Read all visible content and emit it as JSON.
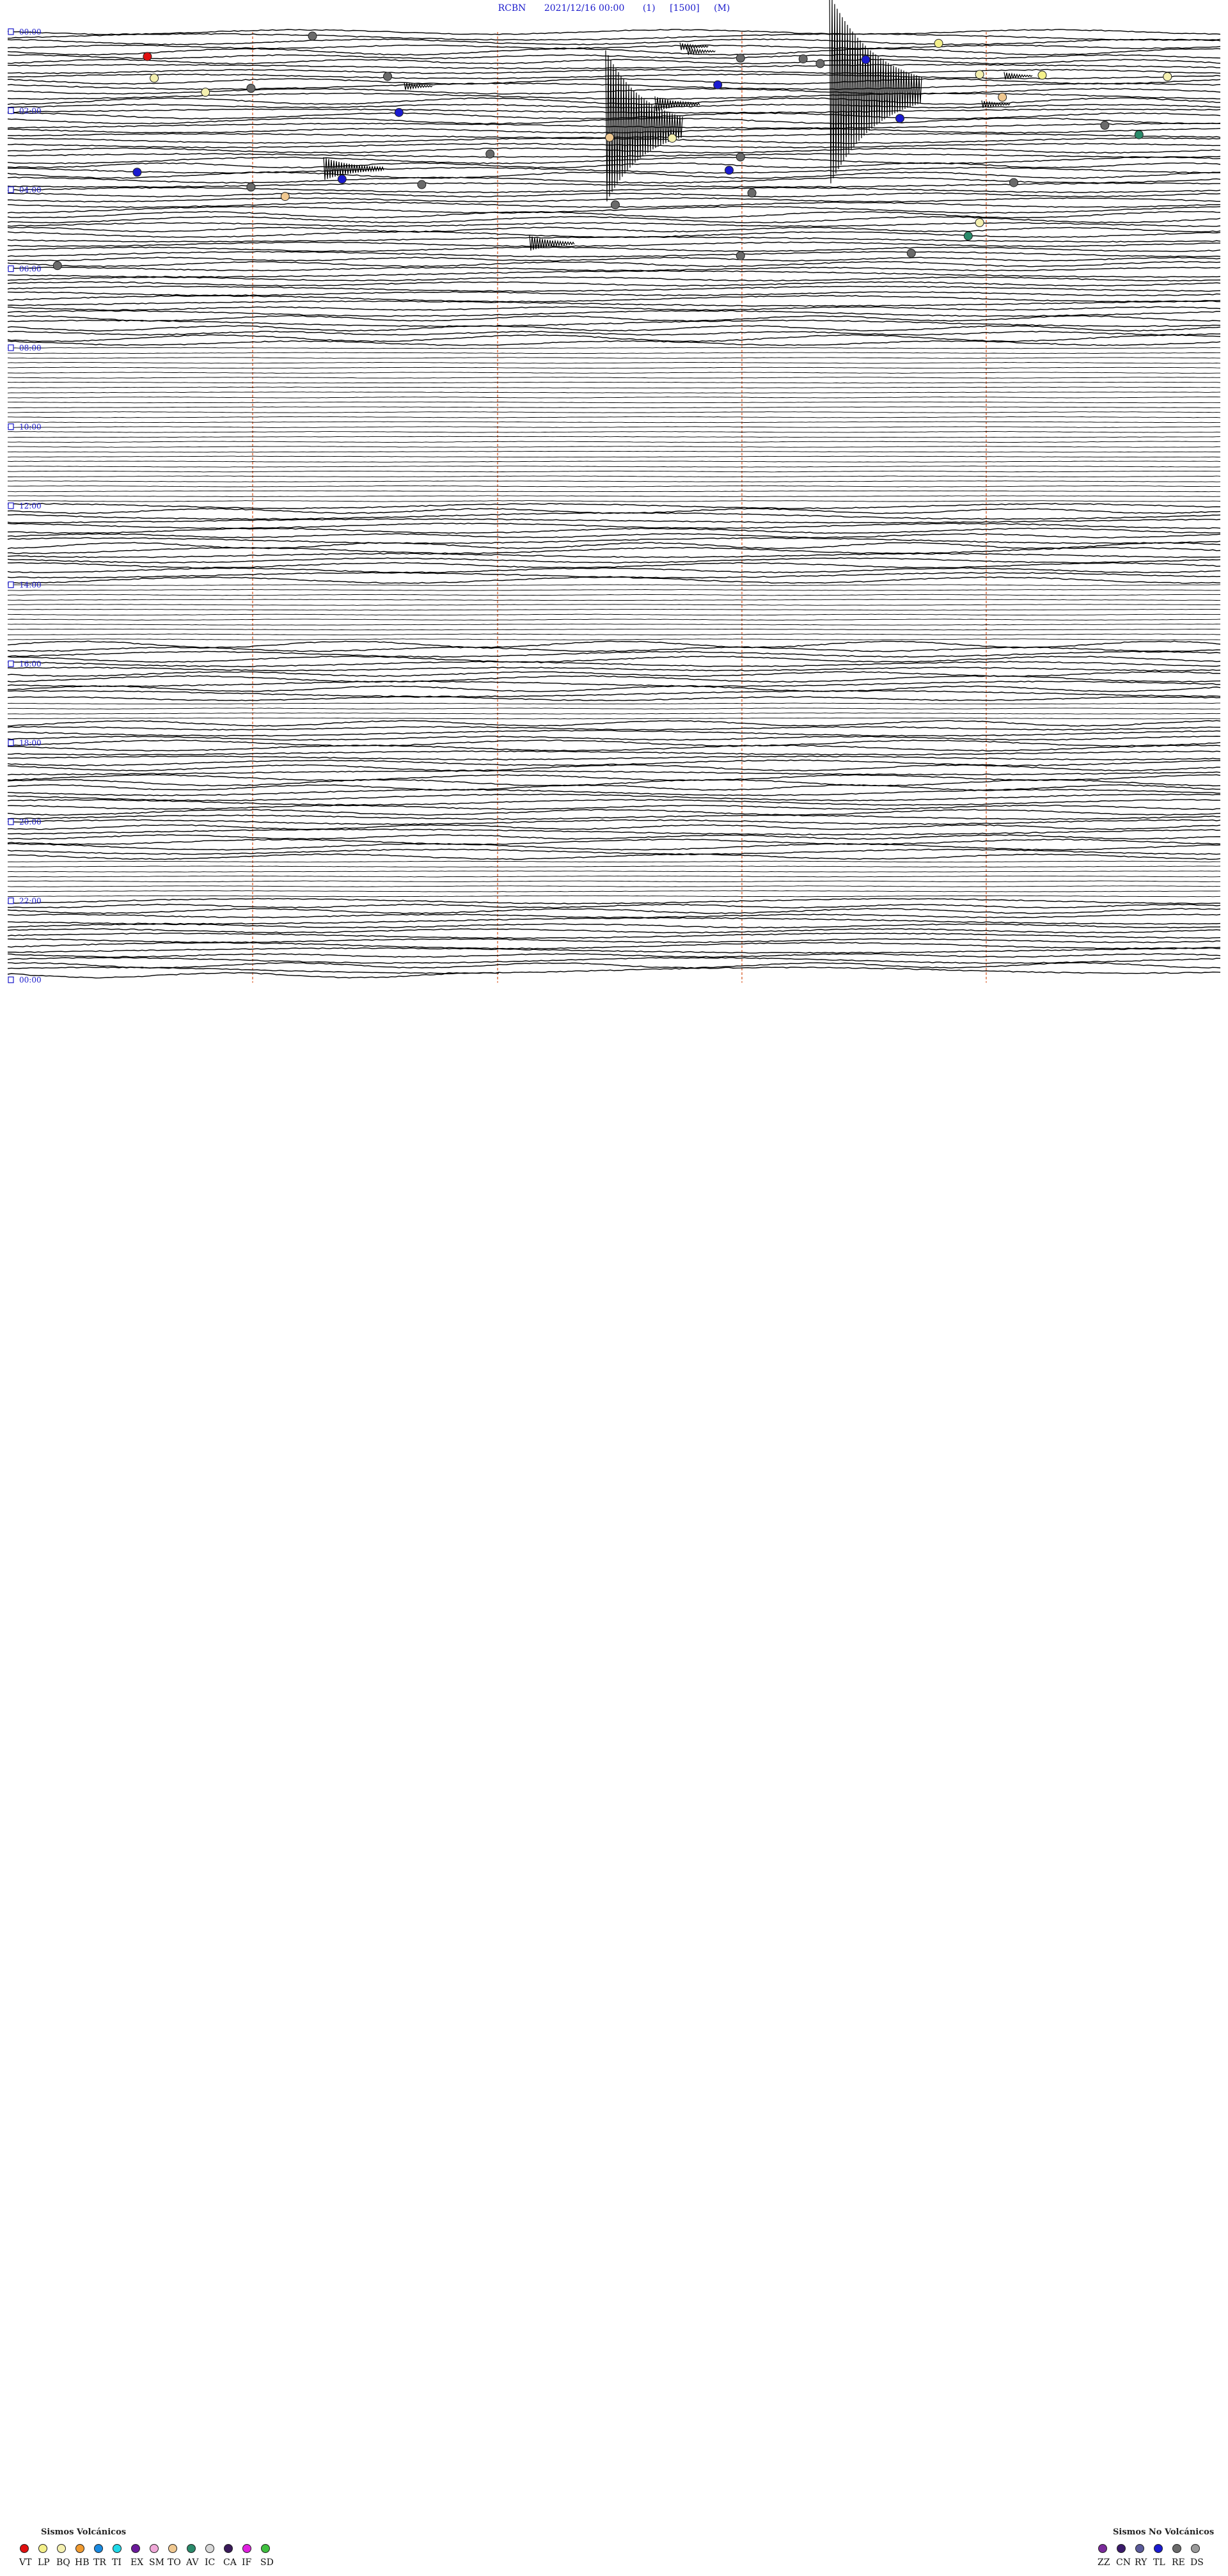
{
  "header": {
    "station": "RCBN",
    "datetime": "2021/12/16 00:00",
    "channel": "(1)",
    "gain": "[1500]",
    "mode": "(M)"
  },
  "chart_data": {
    "type": "helicorder",
    "hour_labels": [
      "00:00",
      "02:00",
      "04:00",
      "06:00",
      "08:00",
      "10:00",
      "12:00",
      "14:00",
      "16:00",
      "18:00",
      "20:00",
      "22:00",
      "00:00"
    ],
    "volcanic_legend_title": "Sismos Volcánicos",
    "volcanic_types": [
      {
        "code": "VT",
        "color": "#e01010"
      },
      {
        "code": "LP",
        "color": "#f4f08a"
      },
      {
        "code": "BQ",
        "color": "#f4f0b0"
      },
      {
        "code": "HB",
        "color": "#f09a30"
      },
      {
        "code": "TR",
        "color": "#1a8ae0"
      },
      {
        "code": "TI",
        "color": "#20d8e8"
      },
      {
        "code": "EX",
        "color": "#6a1a9a"
      },
      {
        "code": "SM",
        "color": "#f0a8d8"
      },
      {
        "code": "TO",
        "color": "#f0c890"
      },
      {
        "code": "AV",
        "color": "#2a8a6a"
      },
      {
        "code": "IC",
        "color": "#d8d8d8"
      },
      {
        "code": "CA",
        "color": "#3a1a5a"
      },
      {
        "code": "IF",
        "color": "#e020e0"
      },
      {
        "code": "SD",
        "color": "#40c040"
      }
    ],
    "nonvolcanic_legend_title": "Sismos No Volcánicos",
    "nonvolcanic_types": [
      {
        "code": "ZZ",
        "color": "#7a2a9a"
      },
      {
        "code": "CN",
        "color": "#3a1a6a"
      },
      {
        "code": "RY",
        "color": "#5a5a9a"
      },
      {
        "code": "TL",
        "color": "#1a1ad0"
      },
      {
        "code": "RE",
        "color": "#6a6a6a"
      },
      {
        "code": "DS",
        "color": "#9a9a9a"
      }
    ],
    "events": [
      {
        "type": "RE",
        "t": 0.82
      },
      {
        "type": "LP",
        "t": 2.32
      },
      {
        "type": "VT",
        "t": 4.97
      },
      {
        "type": "RE",
        "t": 5.3
      },
      {
        "type": "TL",
        "t": 5.6
      },
      {
        "type": "RE",
        "t": 5.45
      },
      {
        "type": "RE",
        "t": 6.4
      },
      {
        "type": "BQ",
        "t": 8.6
      },
      {
        "type": "LP",
        "t": 8.75
      },
      {
        "type": "BQ",
        "t": 9.05
      },
      {
        "type": "RE",
        "t": 9.0
      },
      {
        "type": "BQ",
        "t": 9.35
      },
      {
        "type": "TL",
        "t": 10.7
      },
      {
        "type": "RE",
        "t": 11.4
      },
      {
        "type": "BQ",
        "t": 12.2
      },
      {
        "type": "TO",
        "t": 13.2
      },
      {
        "type": "TL",
        "t": 16.3
      },
      {
        "type": "TL",
        "t": 17.5
      },
      {
        "type": "RE",
        "t": 18.9
      },
      {
        "type": "AV",
        "t": 20.8
      },
      {
        "type": "BQ",
        "t": 21.5
      },
      {
        "type": "TO",
        "t": 21.35
      },
      {
        "type": "RE",
        "t": 24.7
      },
      {
        "type": "RE",
        "t": 25.3
      },
      {
        "type": "TL",
        "t": 28.4
      },
      {
        "type": "TL",
        "t": 28.0
      },
      {
        "type": "TL",
        "t": 29.8
      },
      {
        "type": "RE",
        "t": 30.5
      },
      {
        "type": "RE",
        "t": 30.9
      },
      {
        "type": "RE",
        "t": 31.4
      },
      {
        "type": "RE",
        "t": 32.6
      },
      {
        "type": "TO",
        "t": 33.3
      },
      {
        "type": "RE",
        "t": 35.0
      },
      {
        "type": "BQ",
        "t": 38.6
      },
      {
        "type": "AV",
        "t": 41.3
      },
      {
        "type": "RE",
        "t": 44.8
      },
      {
        "type": "RE",
        "t": 45.3
      },
      {
        "type": "RE",
        "t": 47.3
      }
    ],
    "signals": [
      {
        "t": 2.96,
        "kind": "burst",
        "strength": 1
      },
      {
        "t": 3.92,
        "kind": "burst",
        "strength": 1
      },
      {
        "t": 8.9,
        "kind": "burst",
        "strength": 1
      },
      {
        "t": 11.0,
        "kind": "burst",
        "strength": 1
      },
      {
        "t": 11.75,
        "kind": "earthquake",
        "strength": 5
      },
      {
        "t": 14.6,
        "kind": "burst",
        "strength": 2
      },
      {
        "t": 14.65,
        "kind": "burst",
        "strength": 1
      },
      {
        "t": 19.25,
        "kind": "earthquake",
        "strength": 4
      },
      {
        "t": 27.7,
        "kind": "burst",
        "strength": 3
      },
      {
        "t": 42.8,
        "kind": "burst",
        "strength": 2
      }
    ]
  }
}
